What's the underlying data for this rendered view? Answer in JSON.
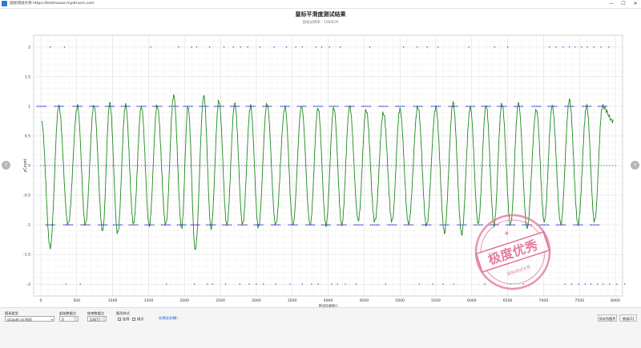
{
  "window": {
    "title": "鼠标测试大师 https://testmouse.mydrivers.com",
    "controls": {
      "minimize": "—",
      "maximize": "☐",
      "close": "✕"
    }
  },
  "chart_data": {
    "type": "scatter",
    "title": "鼠标平滑度测试结果",
    "subtitle": "鼠标分辨率：1000CPI",
    "xlabel": "时间(毫秒)",
    "ylabel": "yCount",
    "xlim": [
      -100,
      8100
    ],
    "ylim": [
      -2.2,
      2.2
    ],
    "x_ticks": [
      0,
      500,
      1000,
      1500,
      2000,
      2500,
      3000,
      3500,
      4000,
      4500,
      5000,
      5500,
      6000,
      6500,
      7000,
      7500,
      8000
    ],
    "y_ticks": [
      2,
      1.5,
      1,
      0.5,
      0,
      -0.5,
      -1,
      -1.5,
      -2
    ],
    "y_tick_labels": [
      "2",
      "1.5",
      "1",
      "0.5",
      "0",
      "-0.5",
      "-1",
      "-1.5",
      "-2"
    ],
    "grid": true,
    "series": [
      {
        "color": "#2b2bd0",
        "marker": "dot",
        "levels": [
          2,
          1,
          0,
          -1,
          -2
        ],
        "points_at_2": [
          130,
          330,
          1530,
          1920,
          2100,
          2170,
          2350,
          2550,
          2680,
          2780,
          2880,
          3050,
          3250,
          3420,
          3550,
          3640,
          3830,
          3910,
          4020,
          4170,
          4580,
          5050,
          5240,
          5380,
          5530,
          5960,
          6320,
          6500,
          7080,
          7170,
          7270,
          7360,
          7440,
          7530,
          7610,
          7700,
          7800,
          7910
        ]
      },
      {
        "color": "#1d8a1d",
        "marker": "line",
        "peaks": [
          [
            10,
            0.75
          ],
          [
            250,
            1.0
          ],
          [
            510,
            1.0
          ],
          [
            740,
            1.02
          ],
          [
            960,
            1.05
          ],
          [
            1180,
            1.02
          ],
          [
            1400,
            1.0
          ],
          [
            1620,
            1.02
          ],
          [
            1850,
            1.18
          ],
          [
            2050,
            1.0
          ],
          [
            2270,
            1.18
          ],
          [
            2480,
            1.1
          ],
          [
            2700,
            1.05
          ],
          [
            2920,
            1.0
          ],
          [
            3150,
            1.05
          ],
          [
            3400,
            0.98
          ],
          [
            3630,
            1.0
          ],
          [
            3860,
            0.98
          ],
          [
            4080,
            0.98
          ],
          [
            4300,
            1.0
          ],
          [
            4530,
            0.95
          ],
          [
            4770,
            0.9
          ],
          [
            5000,
            0.95
          ],
          [
            5250,
            1.0
          ],
          [
            5500,
            0.98
          ],
          [
            5740,
            1.05
          ],
          [
            5980,
            0.98
          ],
          [
            6200,
            1.02
          ],
          [
            6420,
            1.05
          ],
          [
            6650,
            1.05
          ],
          [
            6900,
            0.95
          ],
          [
            7120,
            1.0
          ],
          [
            7360,
            1.1
          ],
          [
            7600,
            1.0
          ],
          [
            7820,
            1.0
          ]
        ],
        "troughs": [
          [
            130,
            -1.38
          ],
          [
            380,
            -1.0
          ],
          [
            620,
            -1.0
          ],
          [
            860,
            -1.1
          ],
          [
            1070,
            -1.15
          ],
          [
            1290,
            -0.98
          ],
          [
            1510,
            -1.0
          ],
          [
            1740,
            -1.0
          ],
          [
            1960,
            -1.05
          ],
          [
            2150,
            -1.42
          ],
          [
            2370,
            -1.05
          ],
          [
            2590,
            -1.0
          ],
          [
            2810,
            -1.0
          ],
          [
            3030,
            -1.05
          ],
          [
            3270,
            -1.0
          ],
          [
            3510,
            -1.0
          ],
          [
            3750,
            -1.0
          ],
          [
            3970,
            -1.0
          ],
          [
            4190,
            -1.0
          ],
          [
            4420,
            -0.92
          ],
          [
            4650,
            -0.95
          ],
          [
            4890,
            -0.95
          ],
          [
            5120,
            -0.98
          ],
          [
            5370,
            -1.02
          ],
          [
            5620,
            -1.12
          ],
          [
            5860,
            -1.15
          ],
          [
            6090,
            -0.98
          ],
          [
            6310,
            -1.0
          ],
          [
            6540,
            -1.0
          ],
          [
            6770,
            -1.05
          ],
          [
            7010,
            -0.95
          ],
          [
            7240,
            -0.98
          ],
          [
            7480,
            -0.98
          ],
          [
            7710,
            -0.95
          ]
        ],
        "end": [
          7970,
          0.75
        ]
      }
    ]
  },
  "stamp": {
    "big_text": "极度优秀",
    "small_text": "鼠标测试大师",
    "color": "#e0709a"
  },
  "bottom": {
    "chart_type_label": "图表类型",
    "chart_type_value": "yCount vs 时间",
    "start_label": "起始数据点",
    "start_value": "0",
    "end_label": "结束数据点",
    "end_value": "53677",
    "style_label": "图形样式",
    "opt_connect": "连线",
    "opt_dots": "描点",
    "help_link": "结果图说明",
    "help_count": "(8)",
    "save_button": "另存为图片",
    "close_button": "关闭(C)"
  },
  "nav": {
    "prev": "‹",
    "next": "›"
  }
}
